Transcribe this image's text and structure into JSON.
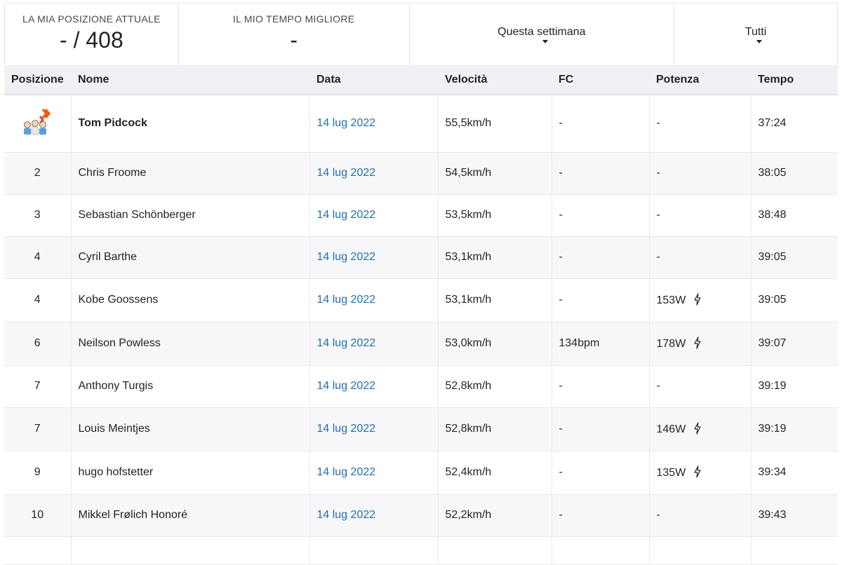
{
  "stats": {
    "position_label": "LA MIA POSIZIONE ATTUALE",
    "position_value": "- / 408",
    "best_time_label": "IL MIO TEMPO MIGLIORE",
    "best_time_value": "-"
  },
  "filters": {
    "period": "Questa settimana",
    "group": "Tutti"
  },
  "table": {
    "headers": {
      "rank": "Posizione",
      "name": "Nome",
      "date": "Data",
      "speed": "Velocità",
      "hr": "FC",
      "power": "Potenza",
      "time": "Tempo"
    },
    "rows": [
      {
        "rank": "",
        "name": "Tom Pidcock",
        "date": "14 lug 2022",
        "speed": "55,5km/h",
        "hr": "-",
        "power": "-",
        "time": "37:24"
      },
      {
        "rank": "2",
        "name": "Chris Froome",
        "date": "14 lug 2022",
        "speed": "54,5km/h",
        "hr": "-",
        "power": "-",
        "time": "38:05"
      },
      {
        "rank": "3",
        "name": "Sebastian Schönberger",
        "date": "14 lug 2022",
        "speed": "53,5km/h",
        "hr": "-",
        "power": "-",
        "time": "38:48"
      },
      {
        "rank": "4",
        "name": "Cyril Barthe",
        "date": "14 lug 2022",
        "speed": "53,1km/h",
        "hr": "-",
        "power": "-",
        "time": "39:05"
      },
      {
        "rank": "4",
        "name": "Kobe Goossens",
        "date": "14 lug 2022",
        "speed": "53,1km/h",
        "hr": "-",
        "power": "153W",
        "time": "39:05"
      },
      {
        "rank": "6",
        "name": "Neilson Powless",
        "date": "14 lug 2022",
        "speed": "53,0km/h",
        "hr": "134bpm",
        "power": "178W",
        "time": "39:07"
      },
      {
        "rank": "7",
        "name": "Anthony Turgis",
        "date": "14 lug 2022",
        "speed": "52,8km/h",
        "hr": "-",
        "power": "-",
        "time": "39:19"
      },
      {
        "rank": "7",
        "name": "Louis Meintjes",
        "date": "14 lug 2022",
        "speed": "52,8km/h",
        "hr": "-",
        "power": "146W",
        "time": "39:19"
      },
      {
        "rank": "9",
        "name": "hugo hofstetter",
        "date": "14 lug 2022",
        "speed": "52,4km/h",
        "hr": "-",
        "power": "135W",
        "time": "39:34"
      },
      {
        "rank": "10",
        "name": "Mikkel Frølich Honoré",
        "date": "14 lug 2022",
        "speed": "52,2km/h",
        "hr": "-",
        "power": "-",
        "time": "39:43"
      }
    ]
  },
  "icons": {
    "top_rank": "crown-podium-icon",
    "power_source": "lightning-bolt-icon",
    "dropdown": "caret-down-icon"
  },
  "colors": {
    "link": "#1f6fae",
    "accent": "#fc5200",
    "header_bg": "#f0f0f5",
    "stripe_bg": "#f7f7fa"
  }
}
